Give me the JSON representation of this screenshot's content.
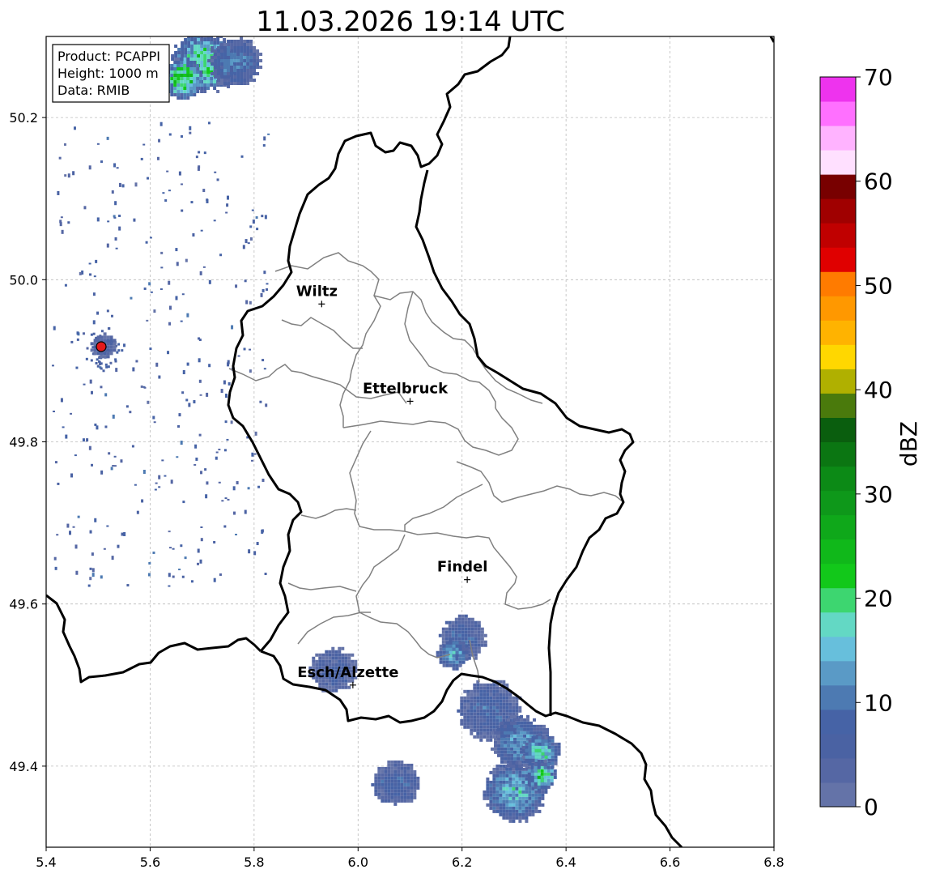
{
  "title": "11.03.2026 19:14 UTC",
  "info_box": {
    "lines": [
      "Product: PCAPPI",
      "Height: 1000 m",
      "Data: RMIB"
    ]
  },
  "map": {
    "lon_range": [
      5.4,
      6.8
    ],
    "lat_range": [
      49.3,
      50.3
    ],
    "x_ticks": [
      "5.4",
      "5.6",
      "5.8",
      "6.0",
      "6.2",
      "6.4",
      "6.6",
      "6.8"
    ],
    "y_ticks": [
      "49.4",
      "49.6",
      "49.8",
      "50.0",
      "50.2"
    ],
    "grid": true,
    "cities": [
      {
        "name": "Wiltz",
        "lon": 5.93,
        "lat": 49.97
      },
      {
        "name": "Ettelbruck",
        "lon": 6.1,
        "lat": 49.85
      },
      {
        "name": "Findel",
        "lon": 6.21,
        "lat": 49.63
      },
      {
        "name": "Esch/Alzette",
        "lon": 5.99,
        "lat": 49.5
      }
    ],
    "radar_site": {
      "lon": 5.505,
      "lat": 49.915,
      "color": "#e31a1c"
    },
    "border_color": "#000000",
    "canton_color": "#808080"
  },
  "colorbar": {
    "label": "dBZ",
    "min": 0,
    "max": 70,
    "tick_labels": [
      "0",
      "10",
      "20",
      "30",
      "40",
      "50",
      "60",
      "70"
    ],
    "colors": [
      "#6473a8",
      "#5567a4",
      "#4a62a3",
      "#4663a6",
      "#4d7ab2",
      "#5a9ac6",
      "#67bfdc",
      "#63d8c4",
      "#3dd670",
      "#12c81a",
      "#10b81a",
      "#0fa81a",
      "#0e981a",
      "#0c8a16",
      "#0b7612",
      "#0a5e0e",
      "#4a7a0c",
      "#b0b000",
      "#ffd700",
      "#ffb300",
      "#ff9800",
      "#ff7b00",
      "#e00000",
      "#c00000",
      "#a00000",
      "#780000",
      "#ffe0ff",
      "#ffb3ff",
      "#ff70ff",
      "#ee33ee"
    ]
  },
  "echoes": [
    {
      "lon": 5.7,
      "lat": 50.27,
      "dbz": 20,
      "r": 0.06
    },
    {
      "lon": 5.66,
      "lat": 50.25,
      "dbz": 22,
      "r": 0.04
    },
    {
      "lon": 5.76,
      "lat": 50.27,
      "dbz": 10,
      "r": 0.05
    },
    {
      "lon": 6.2,
      "lat": 49.56,
      "dbz": 8,
      "r": 0.045
    },
    {
      "lon": 6.18,
      "lat": 49.54,
      "dbz": 14,
      "r": 0.03
    },
    {
      "lon": 5.95,
      "lat": 49.52,
      "dbz": 6,
      "r": 0.045
    },
    {
      "lon": 6.25,
      "lat": 49.47,
      "dbz": 8,
      "r": 0.06
    },
    {
      "lon": 6.31,
      "lat": 49.43,
      "dbz": 12,
      "r": 0.055
    },
    {
      "lon": 6.35,
      "lat": 49.42,
      "dbz": 18,
      "r": 0.035
    },
    {
      "lon": 6.3,
      "lat": 49.37,
      "dbz": 14,
      "r": 0.06
    },
    {
      "lon": 6.35,
      "lat": 49.39,
      "dbz": 20,
      "r": 0.03
    },
    {
      "lon": 6.07,
      "lat": 49.38,
      "dbz": 8,
      "r": 0.045
    },
    {
      "lon": 5.51,
      "lat": 49.92,
      "dbz": 6,
      "r": 0.025
    }
  ]
}
